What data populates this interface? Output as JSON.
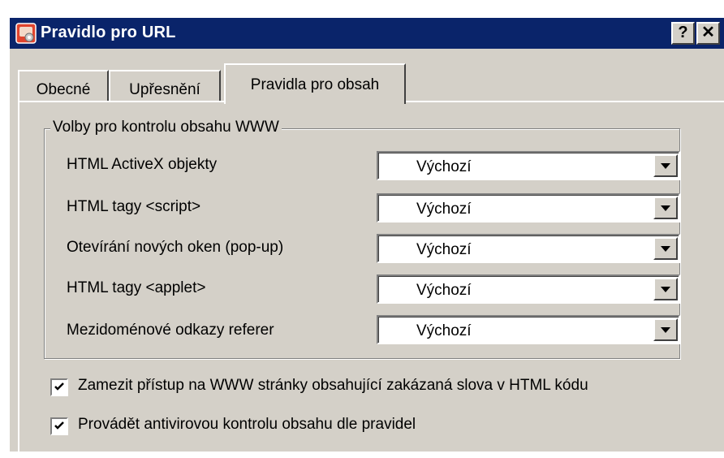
{
  "window": {
    "title": "Pravidlo pro URL",
    "help_button": "?",
    "close_button": "✕"
  },
  "tabs": [
    {
      "label": "Obecné",
      "selected": false
    },
    {
      "label": "Upřesnění",
      "selected": false
    },
    {
      "label": "Pravidla pro obsah",
      "selected": true
    }
  ],
  "group": {
    "legend": "Volby pro kontrolu obsahu WWW",
    "rows": [
      {
        "label": "HTML ActiveX objekty",
        "value": "Výchozí"
      },
      {
        "label": "HTML tagy <script>",
        "value": "Výchozí"
      },
      {
        "label": "Otevírání nových oken (pop-up)",
        "value": "Výchozí"
      },
      {
        "label": "HTML tagy <applet>",
        "value": "Výchozí"
      },
      {
        "label": "Mezidoménové odkazy referer",
        "value": "Výchozí"
      }
    ]
  },
  "checkboxes": [
    {
      "label": "Zamezit přístup na WWW stránky obsahující zakázaná slova v HTML kódu",
      "checked": true
    },
    {
      "label": "Provádět antivirovou kontrolu obsahu dle pravidel",
      "checked": true
    }
  ],
  "colors": {
    "titlebar": "#0a246a",
    "face": "#d4d0c8"
  }
}
